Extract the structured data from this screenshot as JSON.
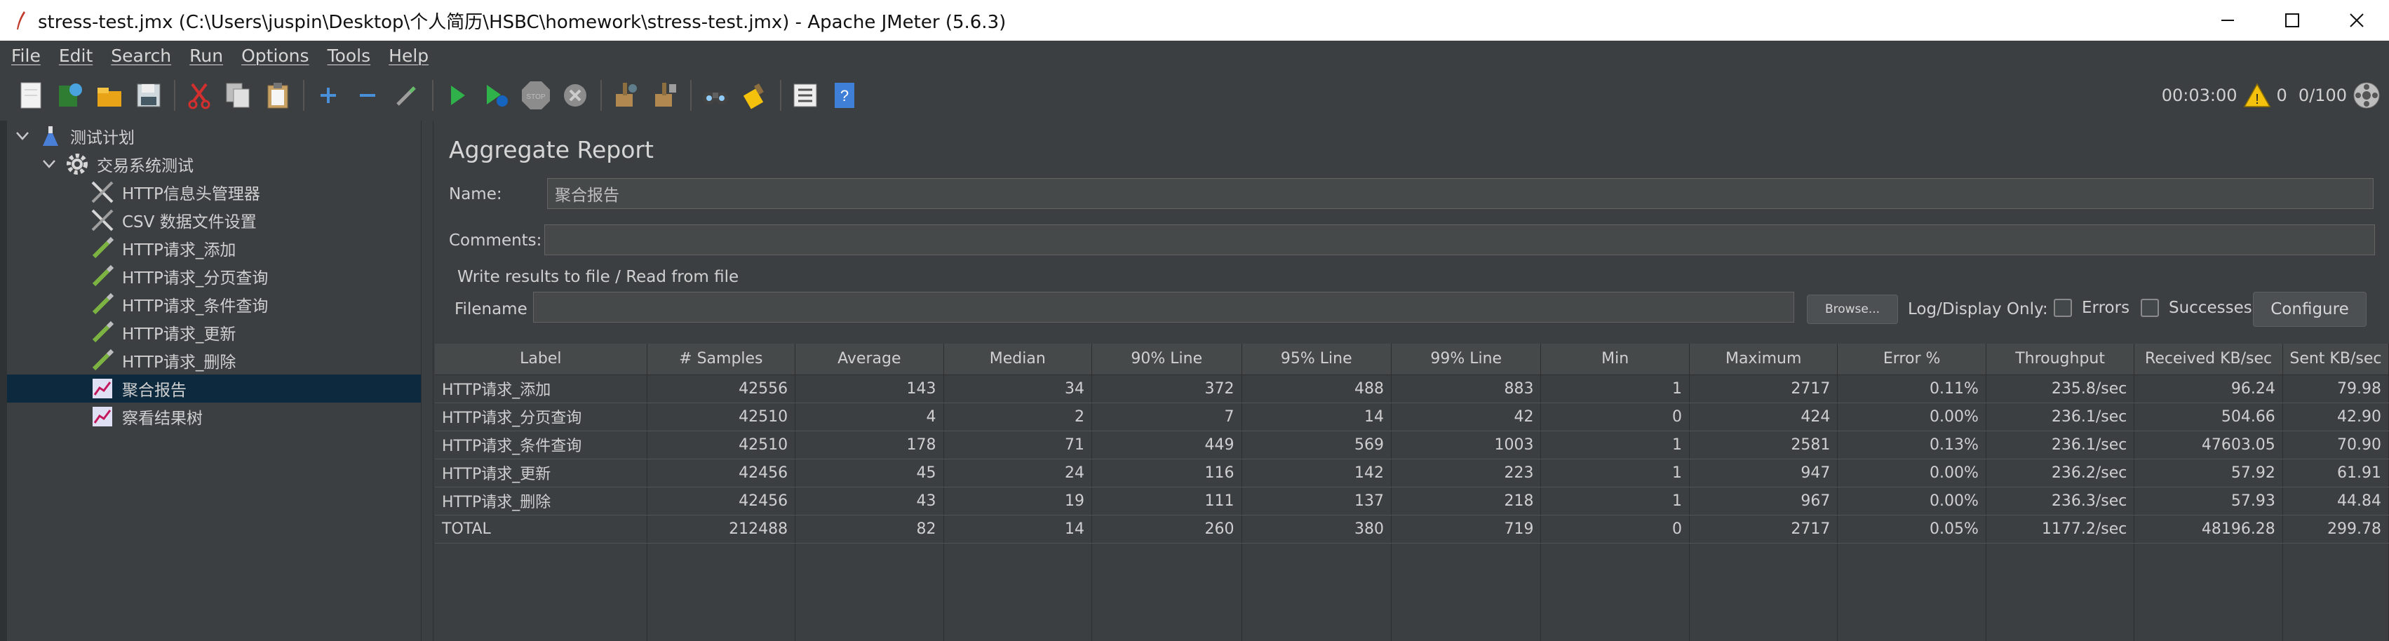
{
  "window": {
    "title": "stress-test.jmx (C:\\Users\\juspin\\Desktop\\个人简历\\HSBC\\homework\\stress-test.jmx) - Apache JMeter (5.6.3)",
    "buttons": [
      "minimize-icon",
      "maximize-icon",
      "close-icon"
    ]
  },
  "menu": [
    "File",
    "Edit",
    "Search",
    "Run",
    "Options",
    "Tools",
    "Help"
  ],
  "toolbar": {
    "icons": [
      "new-icon",
      "templates-icon",
      "open-icon",
      "save-icon",
      "cut-icon",
      "copy-icon",
      "paste-icon",
      "expand-icon",
      "collapse-icon",
      "toggle-icon",
      "start-icon",
      "start-no-pause-icon",
      "stop-icon",
      "shutdown-icon",
      "clear-icon",
      "clear-all-icon",
      "search-icon",
      "reset-search-icon",
      "function-helper-icon",
      "help-icon"
    ],
    "elapsed": "00:03:00",
    "warning_count": "0",
    "threads": "0/100"
  },
  "tree": [
    {
      "label": "测试计划",
      "icon": "flask-icon",
      "level": 0,
      "expanded": true
    },
    {
      "label": "交易系统测试",
      "icon": "gear-icon",
      "level": 1,
      "expanded": true
    },
    {
      "label": "HTTP信息头管理器",
      "icon": "wrench-icon",
      "level": 2
    },
    {
      "label": "CSV 数据文件设置",
      "icon": "wrench-icon",
      "level": 2
    },
    {
      "label": "HTTP请求_添加",
      "icon": "pipette-icon",
      "level": 2
    },
    {
      "label": "HTTP请求_分页查询",
      "icon": "pipette-icon",
      "level": 2
    },
    {
      "label": "HTTP请求_条件查询",
      "icon": "pipette-icon",
      "level": 2
    },
    {
      "label": "HTTP请求_更新",
      "icon": "pipette-icon",
      "level": 2
    },
    {
      "label": "HTTP请求_删除",
      "icon": "pipette-icon",
      "level": 2
    },
    {
      "label": "聚合报告",
      "icon": "chart-icon",
      "level": 2,
      "selected": true
    },
    {
      "label": "察看结果树",
      "icon": "chart-icon",
      "level": 2
    }
  ],
  "panel": {
    "title": "Aggregate Report",
    "name_label": "Name:",
    "name_value": "聚合报告",
    "comments_label": "Comments:",
    "comments_value": "",
    "group_title": "Write results to file / Read from file",
    "filename_label": "Filename",
    "filename_value": "",
    "browse": "Browse...",
    "log_display": "Log/Display Only:",
    "errors": "Errors",
    "successes": "Successes",
    "configure": "Configure"
  },
  "table": {
    "columns": [
      "Label",
      "# Samples",
      "Average",
      "Median",
      "90% Line",
      "95% Line",
      "99% Line",
      "Min",
      "Maximum",
      "Error %",
      "Throughput",
      "Received KB/sec",
      "Sent KB/sec"
    ],
    "rows": [
      [
        "HTTP请求_添加",
        "42556",
        "143",
        "34",
        "372",
        "488",
        "883",
        "1",
        "2717",
        "0.11%",
        "235.8/sec",
        "96.24",
        "79.98"
      ],
      [
        "HTTP请求_分页查询",
        "42510",
        "4",
        "2",
        "7",
        "14",
        "42",
        "0",
        "424",
        "0.00%",
        "236.1/sec",
        "504.66",
        "42.90"
      ],
      [
        "HTTP请求_条件查询",
        "42510",
        "178",
        "71",
        "449",
        "569",
        "1003",
        "1",
        "2581",
        "0.13%",
        "236.1/sec",
        "47603.05",
        "70.90"
      ],
      [
        "HTTP请求_更新",
        "42456",
        "45",
        "24",
        "116",
        "142",
        "223",
        "1",
        "947",
        "0.00%",
        "236.2/sec",
        "57.92",
        "61.91"
      ],
      [
        "HTTP请求_删除",
        "42456",
        "43",
        "19",
        "111",
        "137",
        "218",
        "1",
        "967",
        "0.00%",
        "236.3/sec",
        "57.93",
        "44.84"
      ],
      [
        "TOTAL",
        "212488",
        "82",
        "14",
        "260",
        "380",
        "719",
        "0",
        "2717",
        "0.05%",
        "1177.2/sec",
        "48196.28",
        "299.78"
      ]
    ]
  }
}
